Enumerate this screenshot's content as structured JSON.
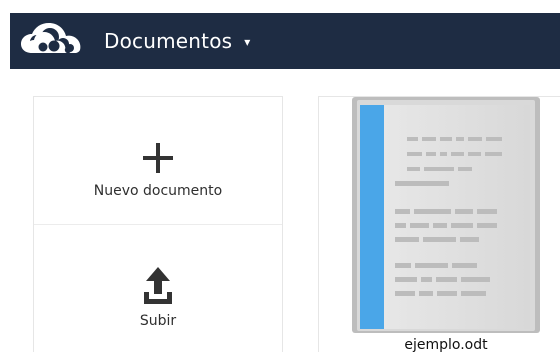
{
  "header": {
    "app_title": "Documentos",
    "caret": "▾",
    "logo": "owncloud-cloud-logo",
    "background_color": "#1e2c43"
  },
  "actions": {
    "new_document": {
      "label": "Nuevo documento",
      "icon": "plus-icon"
    },
    "upload": {
      "label": "Subir",
      "icon": "upload-icon"
    }
  },
  "documents": [
    {
      "name": "ejemplo.odt",
      "icon": "text-document-thumbnail"
    }
  ],
  "colors": {
    "accent_blue": "#4aa6e8",
    "text_dark": "#2f2f2f",
    "doc_gray": "#d8d8d8"
  }
}
